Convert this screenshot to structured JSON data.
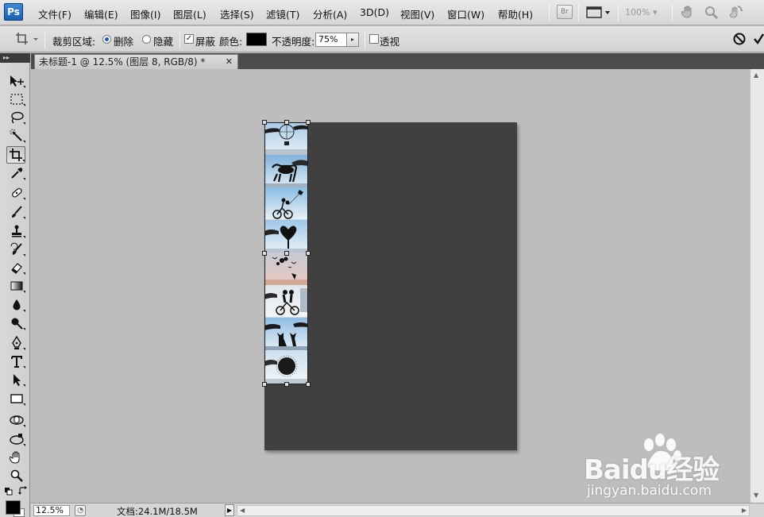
{
  "app": {
    "logo": "Ps"
  },
  "menu": {
    "items": [
      "文件(F)",
      "编辑(E)",
      "图像(I)",
      "图层(L)",
      "选择(S)",
      "滤镜(T)",
      "分析(A)",
      "3D(D)",
      "视图(V)",
      "窗口(W)",
      "帮助(H)"
    ],
    "bridge_label": "Br",
    "zoom_level": "100%",
    "icons": [
      "bridge-icon",
      "screen-mode-icon",
      "hand-tool-icon",
      "zoom-tool-icon",
      "rotate-view-icon"
    ]
  },
  "options_bar": {
    "crop_area_label": "裁剪区域:",
    "delete_label": "删除",
    "hide_label": "隐藏",
    "delete_selected": true,
    "shield_label": "屏蔽",
    "shield_checked": true,
    "color_label": "颜色:",
    "shield_color": "#000000",
    "opacity_label": "不透明度:",
    "opacity_value": "75%",
    "perspective_label": "透视",
    "perspective_checked": false,
    "cancel_icon": "cancel-icon",
    "commit_icon": "commit-icon"
  },
  "tabs": [
    {
      "label": "未标题-1 @ 12.5% (图层 8, RGB/8) *",
      "close": "✕"
    }
  ],
  "tools": [
    "move-tool-icon",
    "marquee-tool-icon",
    "lasso-tool-icon",
    "quick-selection-tool-icon",
    "crop-tool-icon",
    "eyedropper-tool-icon",
    "healing-brush-tool-icon",
    "brush-tool-icon",
    "clone-stamp-tool-icon",
    "history-brush-tool-icon",
    "eraser-tool-icon",
    "gradient-tool-icon",
    "blur-tool-icon",
    "dodge-tool-icon",
    "pen-tool-icon",
    "type-tool-icon",
    "path-selection-tool-icon",
    "shape-tool-icon",
    "3d-rotate-tool-icon",
    "3d-orbit-tool-icon",
    "hand-tool-icon",
    "zoom-tool-icon"
  ],
  "active_tool": "crop-tool-icon",
  "colors": {
    "foreground": "#000000",
    "background": "#ffffff",
    "document_fill": "#404040",
    "workspace": "#bdbdbd"
  },
  "status": {
    "zoom": "12.5%",
    "doc_info": "文档:24.1M/18.5M"
  },
  "watermark": {
    "brand": "Baidu经验",
    "url": "jingyan.baidu.com"
  }
}
